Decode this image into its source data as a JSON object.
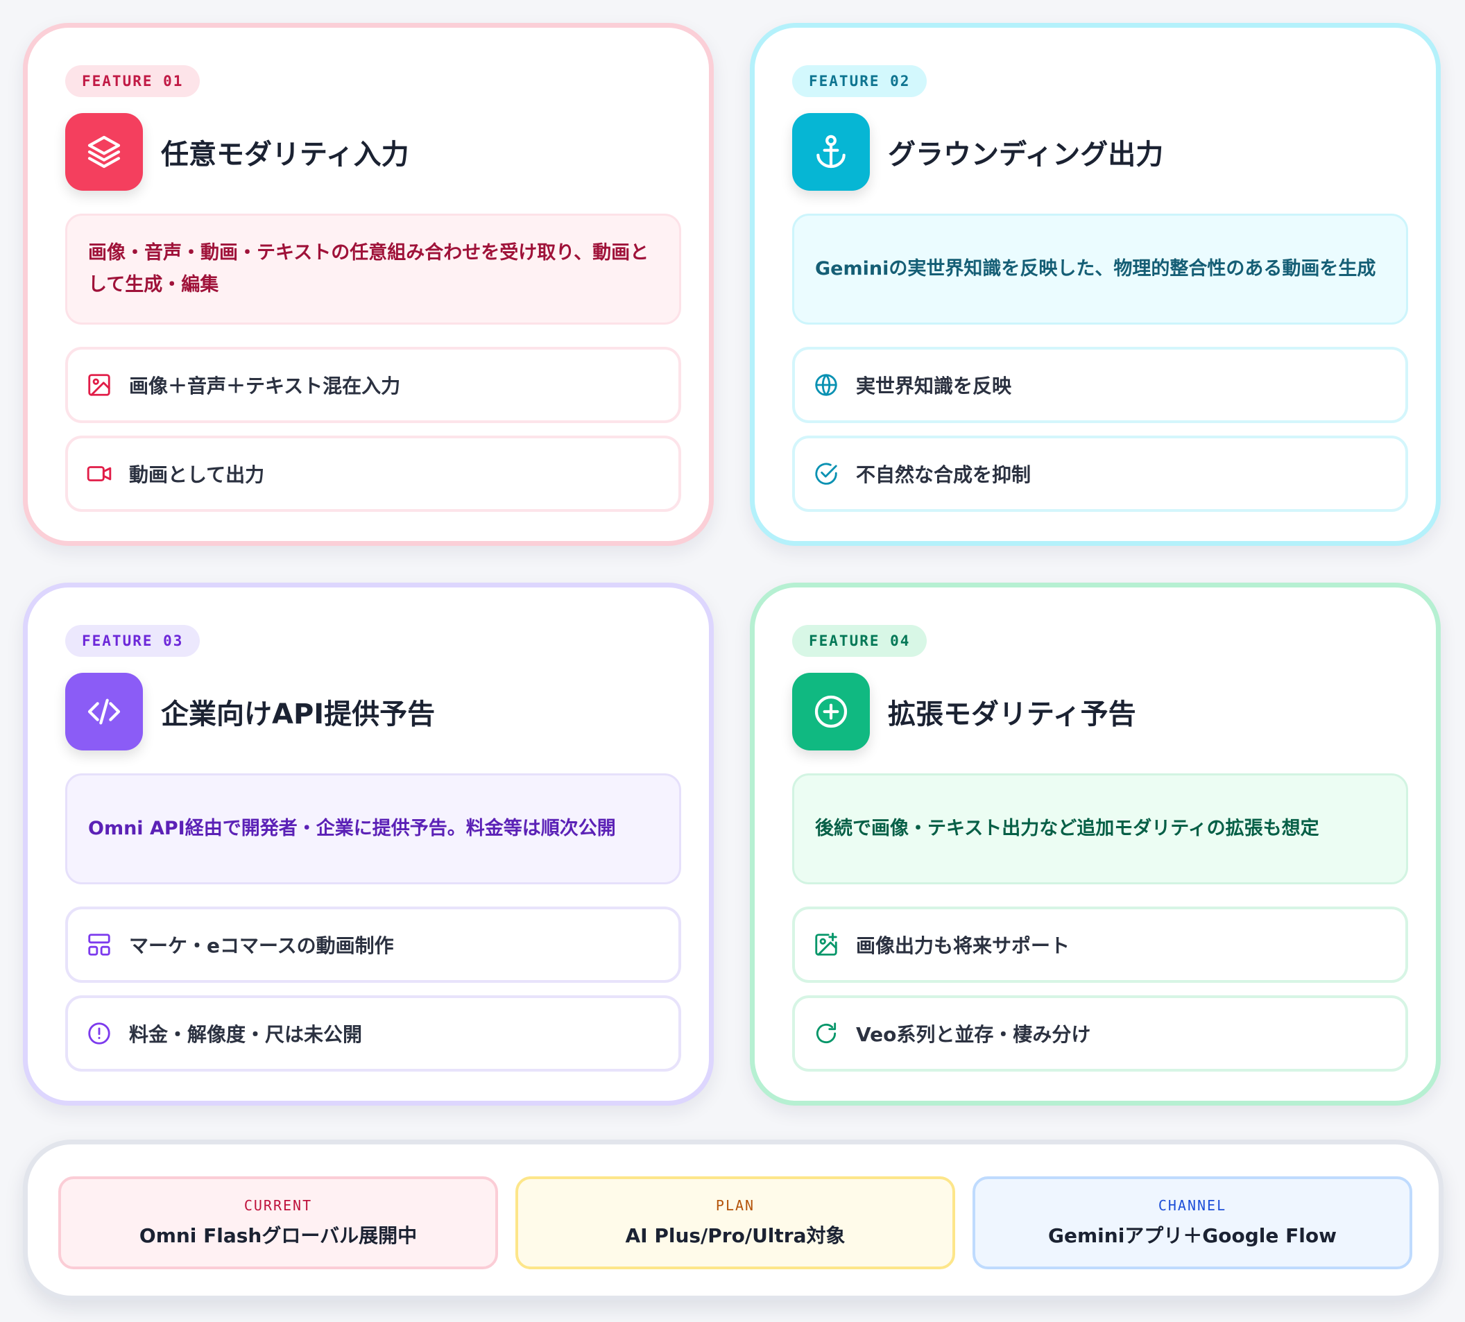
{
  "features": [
    {
      "badge": "FEATURE 01",
      "icon": "layers-icon",
      "title": "任意モダリティ入力",
      "description": "画像・音声・動画・テキストの任意組み合わせを受け取り、動画として生成・編集",
      "items": [
        {
          "icon": "image-icon",
          "label": "画像＋音声＋テキスト混在入力"
        },
        {
          "icon": "video-camera-icon",
          "label": "動画として出力"
        }
      ],
      "accent": "#f43f5e"
    },
    {
      "badge": "FEATURE 02",
      "icon": "anchor-icon",
      "title": "グラウンディング出力",
      "description": "Geminiの実世界知識を反映した、物理的整合性のある動画を生成",
      "items": [
        {
          "icon": "globe-icon",
          "label": "実世界知識を反映"
        },
        {
          "icon": "check-circle-icon",
          "label": "不自然な合成を抑制"
        }
      ],
      "accent": "#06b6d4"
    },
    {
      "badge": "FEATURE 03",
      "icon": "code-icon",
      "title": "企業向けAPI提供予告",
      "description": "Omni API経由で開発者・企業に提供予告。料金等は順次公開",
      "items": [
        {
          "icon": "layout-icon",
          "label": "マーケ・eコマースの動画制作"
        },
        {
          "icon": "alert-circle-icon",
          "label": "料金・解像度・尺は未公開"
        }
      ],
      "accent": "#8b5cf6"
    },
    {
      "badge": "FEATURE 04",
      "icon": "plus-circle-icon",
      "title": "拡張モダリティ予告",
      "description": "後続で画像・テキスト出力など追加モダリティの拡張も想定",
      "items": [
        {
          "icon": "image-plus-icon",
          "label": "画像出力も将来サポート"
        },
        {
          "icon": "refresh-icon",
          "label": "Veo系列と並存・棲み分け"
        }
      ],
      "accent": "#10b981"
    }
  ],
  "stats": [
    {
      "label": "CURRENT",
      "value": "Omni Flashグローバル展開中"
    },
    {
      "label": "PLAN",
      "value": "AI Plus/Pro/Ultra対象"
    },
    {
      "label": "CHANNEL",
      "value": "Geminiアプリ＋Google Flow"
    }
  ]
}
